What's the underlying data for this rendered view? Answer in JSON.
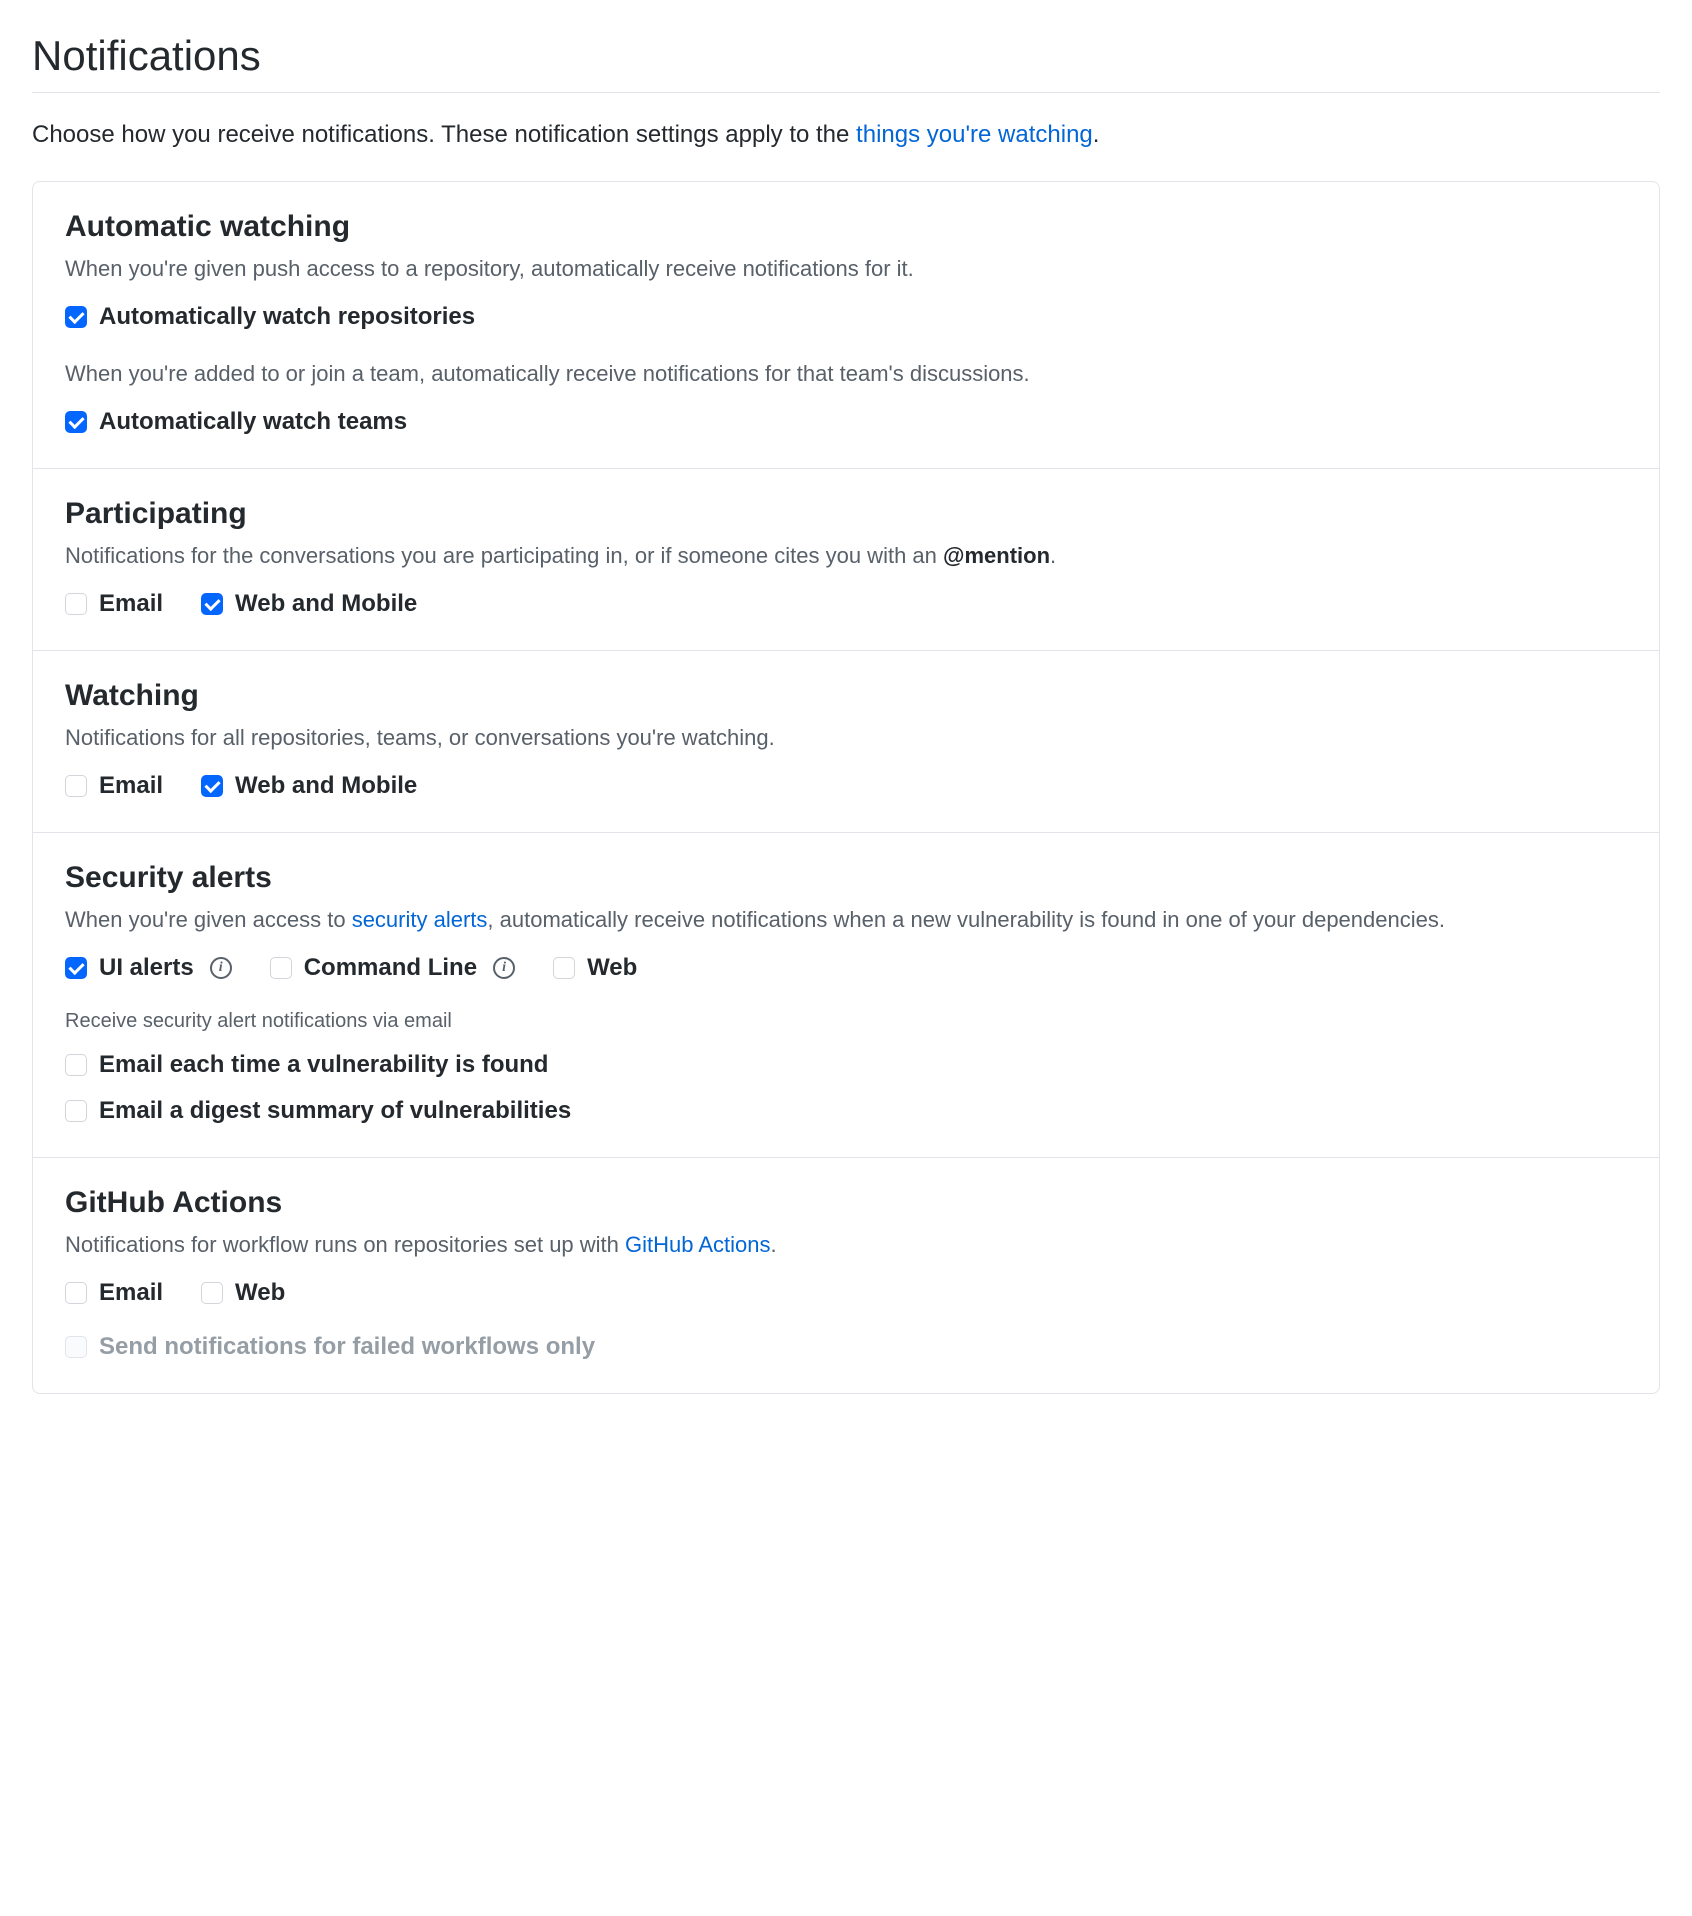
{
  "pageTitle": "Notifications",
  "intro": {
    "text1": "Choose how you receive notifications. These notification settings apply to the ",
    "link": "things you're watching",
    "text2": "."
  },
  "automaticWatching": {
    "title": "Automatic watching",
    "desc1": "When you're given push access to a repository, automatically receive notifications for it.",
    "opt1": "Automatically watch repositories",
    "desc2": "When you're added to or join a team, automatically receive notifications for that team's discussions.",
    "opt2": "Automatically watch teams"
  },
  "participating": {
    "title": "Participating",
    "descPrefix": "Notifications for the conversations you are participating in, or if someone cites you with an ",
    "mention": "@mention",
    "descSuffix": ".",
    "email": "Email",
    "web": "Web and Mobile"
  },
  "watching": {
    "title": "Watching",
    "desc": "Notifications for all repositories, teams, or conversations you're watching.",
    "email": "Email",
    "web": "Web and Mobile"
  },
  "securityAlerts": {
    "title": "Security alerts",
    "descPrefix": "When you're given access to ",
    "link": "security alerts",
    "descSuffix": ", automatically receive notifications when a new vulnerability is found in one of your dependencies.",
    "ui": "UI alerts",
    "cli": "Command Line",
    "web": "Web",
    "emailDesc": "Receive security alert notifications via email",
    "emailEach": "Email each time a vulnerability is found",
    "emailDigest": "Email a digest summary of vulnerabilities"
  },
  "actions": {
    "title": "GitHub Actions",
    "descPrefix": "Notifications for workflow runs on repositories set up with ",
    "link": "GitHub Actions",
    "descSuffix": ".",
    "email": "Email",
    "web": "Web",
    "failedOnly": "Send notifications for failed workflows only"
  }
}
